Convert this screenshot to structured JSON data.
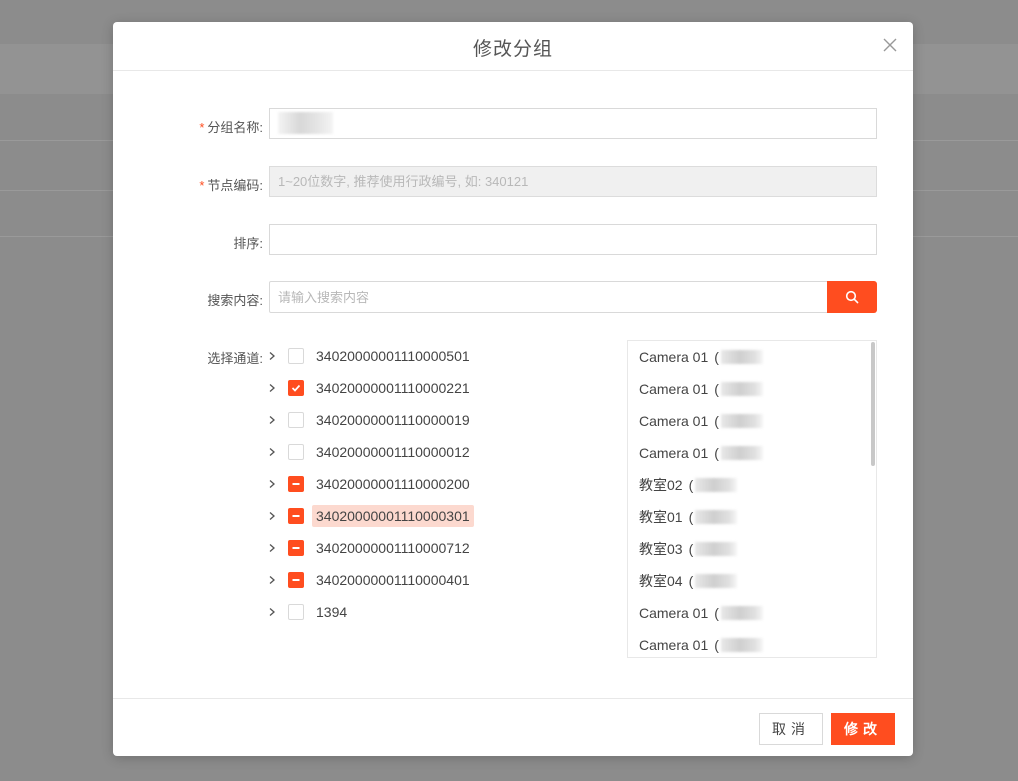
{
  "dialog": {
    "title": "修改分组"
  },
  "form": {
    "group_name": {
      "label": "分组名称:",
      "required_mark": "*",
      "value": ""
    },
    "node_code": {
      "label": "节点编码:",
      "required_mark": "*",
      "placeholder": "1~20位数字, 推荐使用行政编号, 如: 340121"
    },
    "sort": {
      "label": "排序:",
      "value": ""
    },
    "search": {
      "label": "搜索内容:",
      "placeholder": "请输入搜索内容"
    },
    "channels_label": "选择通道:"
  },
  "tree": [
    {
      "label": "34020000001110000501",
      "state": "unchecked",
      "selected": false
    },
    {
      "label": "34020000001110000221",
      "state": "checked",
      "selected": false
    },
    {
      "label": "34020000001110000019",
      "state": "unchecked",
      "selected": false
    },
    {
      "label": "34020000001110000012",
      "state": "unchecked",
      "selected": false
    },
    {
      "label": "34020000001110000200",
      "state": "indeterminate",
      "selected": false
    },
    {
      "label": "34020000001110000301",
      "state": "indeterminate",
      "selected": true
    },
    {
      "label": "34020000001110000712",
      "state": "indeterminate",
      "selected": false
    },
    {
      "label": "34020000001110000401",
      "state": "indeterminate",
      "selected": false
    },
    {
      "label": "1394",
      "state": "unchecked",
      "selected": false
    }
  ],
  "channel_list": [
    {
      "name": "Camera 01",
      "paren": "("
    },
    {
      "name": "Camera 01",
      "paren": "("
    },
    {
      "name": "Camera 01",
      "paren": "("
    },
    {
      "name": "Camera 01",
      "paren": "("
    },
    {
      "name": "教室02",
      "paren": "("
    },
    {
      "name": "教室01",
      "paren": "("
    },
    {
      "name": "教室03",
      "paren": "("
    },
    {
      "name": "教室04",
      "paren": "("
    },
    {
      "name": "Camera 01",
      "paren": "("
    },
    {
      "name": "Camera 01",
      "paren": "("
    }
  ],
  "footer": {
    "cancel_label": "取消",
    "ok_label": "修改"
  },
  "colors": {
    "accent": "#ff4d1f",
    "selected_bg": "#fcd9cf"
  },
  "icons": {
    "close": "close-icon",
    "search": "search-icon",
    "expand": "chevron-right-icon",
    "check": "check-icon",
    "indeterminate": "minus-icon"
  }
}
